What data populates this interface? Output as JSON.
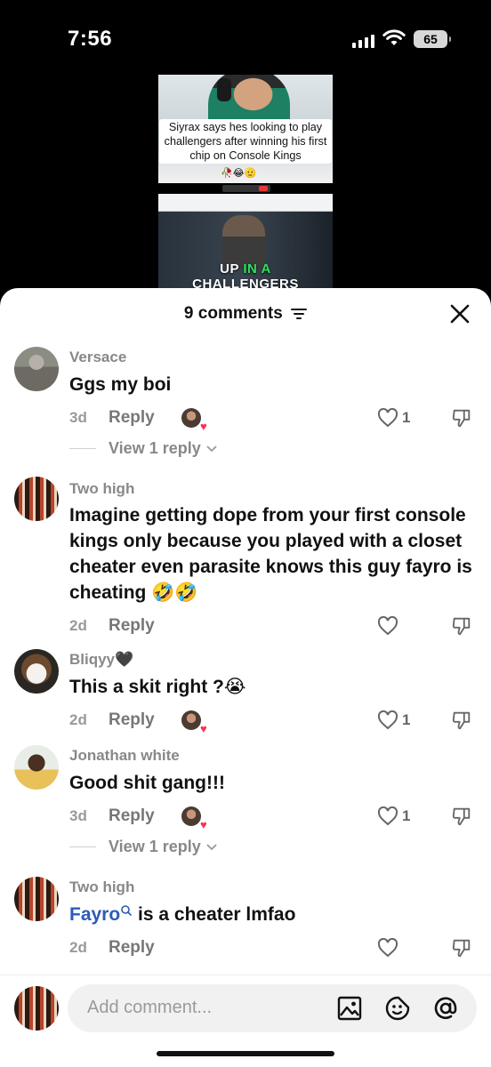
{
  "status_bar": {
    "time": "7:56",
    "battery": "65"
  },
  "video_preview": {
    "caption": "Siyrax says hes looking to play challengers after winning his first chip on Console Kings",
    "caption_emojis": "🥀😂🫡",
    "overlay_text_white_1": "UP",
    "overlay_text_green": "IN A",
    "overlay_text_white_2": "CHALLENGERS"
  },
  "sheet": {
    "title": "9 comments"
  },
  "comments": [
    {
      "username": "Versace",
      "text": "Ggs my boi",
      "date": "3d",
      "reply_label": "Reply",
      "creator_liked": true,
      "likes": "1",
      "view_replies": "View 1 reply"
    },
    {
      "username": "Two high",
      "text": "Imagine getting dope from your first console kings only because you played with a closet cheater even parasite knows this guy fayro is cheating 🤣🤣",
      "date": "2d",
      "reply_label": "Reply",
      "creator_liked": false,
      "likes": ""
    },
    {
      "username": "Bliqyy🖤",
      "text": "This a skit right ?😭",
      "date": "2d",
      "reply_label": "Reply",
      "creator_liked": true,
      "likes": "1"
    },
    {
      "username": "Jonathan white",
      "text": "Good shit gang!!!",
      "date": "3d",
      "reply_label": "Reply",
      "creator_liked": true,
      "likes": "1",
      "view_replies": "View 1 reply"
    },
    {
      "username": "Two high",
      "mention": "Fayro",
      "text": " is a cheater lmfao",
      "date": "2d",
      "reply_label": "Reply",
      "creator_liked": false,
      "likes": ""
    }
  ],
  "input": {
    "placeholder": "Add comment..."
  },
  "icons": {
    "sort": "sort-icon",
    "close": "close-icon",
    "like": "heart-outline-icon",
    "dislike": "thumbs-down-icon",
    "search_mention": "search-icon",
    "image": "image-icon",
    "emoji": "emoji-icon",
    "mention": "at-sign-icon"
  },
  "colors": {
    "mention_blue": "#2b5bb8",
    "creator_heart": "#ff2d55",
    "text_dark": "#111111",
    "text_muted": "#888888"
  }
}
